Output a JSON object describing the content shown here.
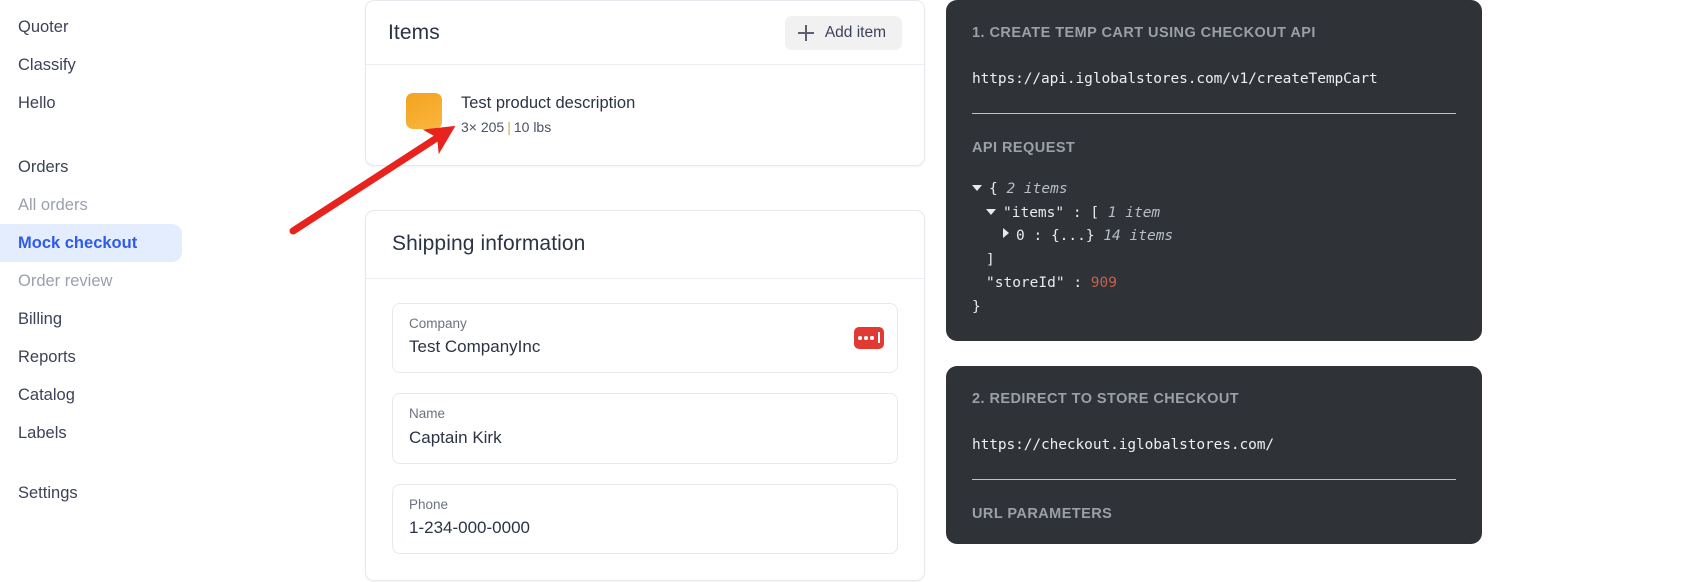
{
  "sidebar": {
    "items": [
      {
        "label": "Quoter",
        "state": "normal"
      },
      {
        "label": "Classify",
        "state": "normal"
      },
      {
        "label": "Hello",
        "state": "normal"
      },
      {
        "label": "Orders",
        "state": "section"
      },
      {
        "label": "All orders",
        "state": "muted"
      },
      {
        "label": "Mock checkout",
        "state": "active"
      },
      {
        "label": "Order review",
        "state": "muted"
      },
      {
        "label": "Billing",
        "state": "normal"
      },
      {
        "label": "Reports",
        "state": "normal"
      },
      {
        "label": "Catalog",
        "state": "normal"
      },
      {
        "label": "Labels",
        "state": "normal"
      },
      {
        "label": "Settings",
        "state": "normal"
      }
    ],
    "active_color": "#2f5bea",
    "active_bg": "#e4edfd"
  },
  "items_card": {
    "title": "Items",
    "add_button_label": "Add item",
    "add_button_icon": "plus-icon",
    "product": {
      "thumbnail_icon": "product-thumbnail",
      "thumbnail_color": "#f5a623",
      "name": "Test product description",
      "quantity": "3×",
      "price": "205",
      "separator": "|",
      "weight": "10 lbs",
      "meta": "3× 205 | 10 lbs"
    }
  },
  "shipping_card": {
    "title": "Shipping information",
    "fields": [
      {
        "label": "Company",
        "value": "Test CompanyInc",
        "badge": "typing-indicator-badge"
      },
      {
        "label": "Name",
        "value": "Captain Kirk"
      },
      {
        "label": "Phone",
        "value": "1-234-000-0000"
      }
    ],
    "badge_color": "#e03a33"
  },
  "api_panels": [
    {
      "heading": "1. CREATE TEMP CART USING CHECKOUT API",
      "url": "https://api.iglobalstores.com/v1/createTempCart",
      "sub_heading": "API REQUEST",
      "json_tree": {
        "root_open": "{",
        "root_count": "2 items",
        "items_key": "\"items\"",
        "items_colon": ":",
        "items_open": "[",
        "items_count": "1 item",
        "child_index": "0",
        "child_colon": ":",
        "child_braces": "{...}",
        "child_count": "14 items",
        "items_close": "]",
        "store_key": "\"storeId\"",
        "store_colon": ":",
        "store_value": "909",
        "root_close": "}"
      }
    },
    {
      "heading": "2. REDIRECT TO STORE CHECKOUT",
      "url": "https://checkout.iglobalstores.com/",
      "sub_heading": "URL PARAMETERS"
    }
  ],
  "annotation": {
    "type": "red-arrow",
    "color": "#e8221d",
    "points_to": "product-thumbnail"
  }
}
